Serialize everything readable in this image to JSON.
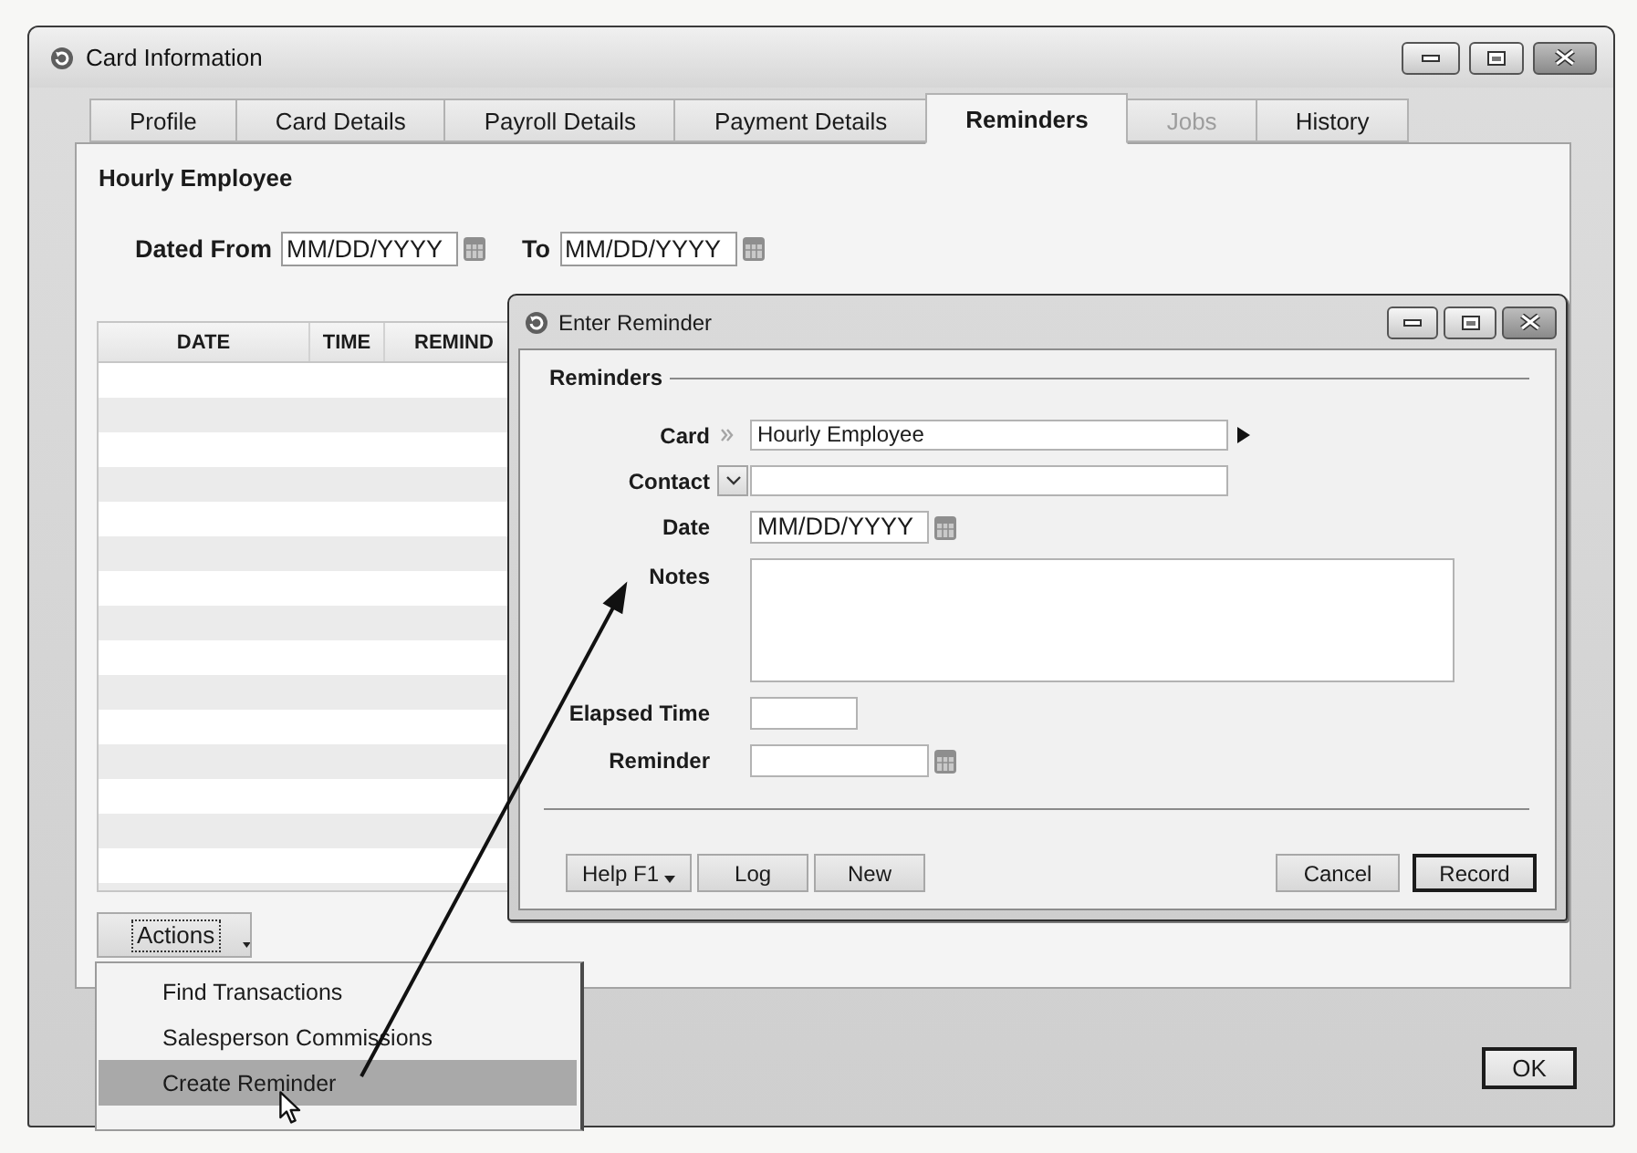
{
  "window": {
    "title": "Card Information"
  },
  "tabs": [
    {
      "label": "Profile",
      "selected": false,
      "disabled": false
    },
    {
      "label": "Card Details",
      "selected": false,
      "disabled": false
    },
    {
      "label": "Payroll Details",
      "selected": false,
      "disabled": false
    },
    {
      "label": "Payment Details",
      "selected": false,
      "disabled": false
    },
    {
      "label": "Reminders",
      "selected": true,
      "disabled": false
    },
    {
      "label": "Jobs",
      "selected": false,
      "disabled": true
    },
    {
      "label": "History",
      "selected": false,
      "disabled": false
    }
  ],
  "panel": {
    "heading": "Hourly Employee",
    "date_filter": [
      {
        "label": "Dated From",
        "value": "MM/DD/YYYY"
      },
      {
        "label": "To",
        "value": "MM/DD/YYYY"
      }
    ],
    "table": {
      "columns": [
        "DATE",
        "TIME",
        "REMIND"
      ]
    },
    "actions_button": {
      "label": "Actions"
    }
  },
  "actions_menu": {
    "items": [
      {
        "label": "Find Transactions",
        "selected": false
      },
      {
        "label": "Salesperson Commissions",
        "selected": false
      },
      {
        "label": "Create Reminder",
        "selected": true
      }
    ]
  },
  "ok_button": {
    "label": "OK"
  },
  "dialog": {
    "title": "Enter Reminder",
    "group_label": "Reminders",
    "fields": [
      {
        "kind": "card",
        "label": "Card",
        "value": "Hourly Employee"
      },
      {
        "kind": "contact",
        "label": "Contact"
      },
      {
        "kind": "date",
        "label": "Date",
        "value": "MM/DD/YYYY"
      },
      {
        "kind": "notes",
        "label": "Notes"
      },
      {
        "kind": "short",
        "label": "Elapsed Time"
      },
      {
        "kind": "date",
        "label": "Reminder"
      }
    ],
    "left_buttons": [
      {
        "label": "Help F1",
        "dropdown": true
      },
      {
        "label": "Log",
        "dropdown": false
      },
      {
        "label": "New",
        "dropdown": false
      }
    ],
    "right_buttons": [
      {
        "label": "Cancel",
        "default": false
      },
      {
        "label": "Record",
        "default": true
      }
    ]
  }
}
